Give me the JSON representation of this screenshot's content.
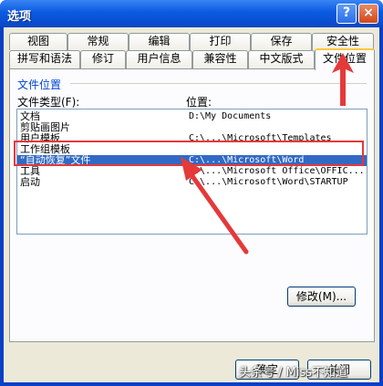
{
  "window": {
    "title": "选项",
    "help_glyph": "?",
    "close_glyph": "×"
  },
  "tabs_row1": [
    "视图",
    "常规",
    "编辑",
    "打印",
    "保存",
    "安全性"
  ],
  "tabs_row2": [
    "拼写和语法",
    "修订",
    "用户信息",
    "兼容性",
    "中文版式",
    "文件位置"
  ],
  "active_tab": "文件位置",
  "panel": {
    "group_label": "文件位置",
    "column_type": "文件类型(F):",
    "column_location": "位置:",
    "rows": [
      {
        "type": "文档",
        "location": "D:\\My Documents"
      },
      {
        "type": "剪贴画图片",
        "location": ""
      },
      {
        "type": "用户模板",
        "location": "C:\\...\\Microsoft\\Templates"
      },
      {
        "type": "工作组模板",
        "location": ""
      },
      {
        "type": "“自动恢复”文件",
        "location": "C:\\...\\Microsoft\\Word"
      },
      {
        "type": "工具",
        "location": "C:\\...\\Microsoft Office\\OFFIC..."
      },
      {
        "type": "启动",
        "location": "C:\\...\\Microsoft\\Word\\STARTUP"
      }
    ],
    "selected_index": 4,
    "modify_button": "修改(M)..."
  },
  "footer": {
    "ok_button": "确定",
    "close_button": "关闭"
  },
  "watermark": "头条号 / Miss不知道",
  "colors": {
    "highlight": "#e5393a",
    "selection": "#316ac5",
    "active_tab_accent": "#ffc83c"
  }
}
